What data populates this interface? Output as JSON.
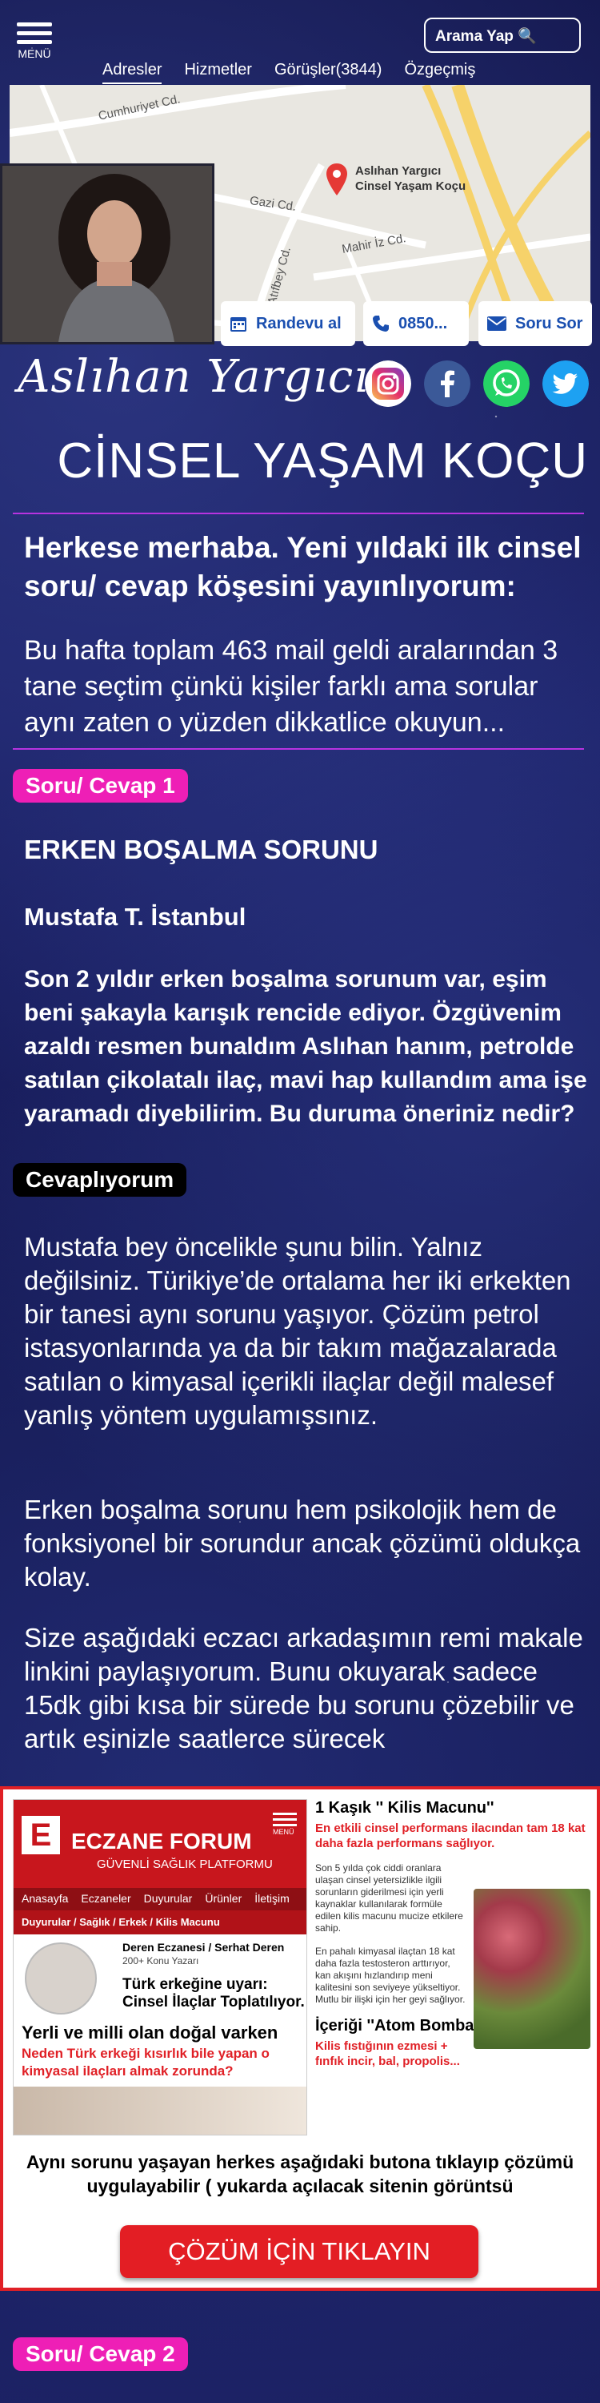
{
  "header": {
    "menu_label": "MENÜ",
    "search_label": "Arama Yap 🔍",
    "nav": [
      "Adresler",
      "Hizmetler",
      "Görüşler(3844)",
      "Özgeçmiş"
    ]
  },
  "map": {
    "streets": [
      "Cumhuriyet Cd.",
      "Gazi Cd.",
      "Mahir İz Cd.",
      "Atıfbey Cd."
    ],
    "pin_label_line1": "Aslıhan Yargıcı",
    "pin_label_line2": "Cinsel Yaşam Koçu"
  },
  "actions": {
    "appointment": "Randevu al",
    "phone": "0850...",
    "question": "Soru Sor"
  },
  "brand": {
    "signature": "Aslıhan Yargıcı",
    "title": "CİNSEL YAŞAM KOÇU",
    "social": [
      "instagram-icon",
      "facebook-icon",
      "whatsapp-icon",
      "twitter-icon"
    ]
  },
  "intro": {
    "lead": "Herkese merhaba. Yeni yıldaki ilk cinsel soru/ cevap köşesini yayınlıyorum:",
    "text": "Bu hafta toplam 463 mail geldi aralarından 3 tane seçtim çünkü kişiler farklı ama sorular aynı zaten o yüzden dikkatlice okuyun..."
  },
  "qa1": {
    "badge": "Soru/ Cevap 1",
    "question_title": "ERKEN BOŞALMA SORUNU",
    "author": "Mustafa T. İstanbul",
    "question": "Son 2 yıldır erken boşalma sorunum var, eşim beni şakayla karışık rencide ediyor. Özgüvenim azaldı resmen bunaldım Aslıhan hanım, petrolde satılan çikolatalı ilaç, mavi hap kullandım ama işe yaramadı diyebilirim. Bu duruma öneriniz nedir?",
    "answer_badge": "Cevaplıyorum",
    "answer_p1": "Mustafa bey öncelikle şunu bilin. Yalnız değilsiniz. Türikiye’de ortalama her iki erkekten bir tanesi aynı sorunu yaşıyor. Çözüm petrol istasyonlarında ya da bir takım mağazalarada satılan o kimyasal içerikli ilaçlar değil malesef yanlış yöntem uygulamışsınız.",
    "answer_p2": "Erken boşalma sorunu hem psikolojik hem de fonksiyonel bir sorundur ancak çözümü oldukça kolay.",
    "answer_p3": "Size aşağıdaki eczacı arkadaşımın remi makale linkini paylaşıyorum. Bunu okuyarak sadece 15dk gibi kısa bir sürede bu sorunu çözebilir ve artık eşinizle saatlerce sürecek"
  },
  "ad": {
    "site_name": "ECZANE FORUM",
    "site_tagline": "GÜVENLİ SAĞLIK PLATFORMU",
    "menu_label": "MENÜ",
    "nav": [
      "Anasayfa",
      "Eczaneler",
      "Duyurular",
      "Ürünler",
      "İletişim"
    ],
    "crumb": "Duyurular / Sağlık / Erkek / Kilis Macunu",
    "author": "Deren Eczanesi / Serhat Deren",
    "author_meta": "200+ Konu Yazarı",
    "warning": "Türk erkeğine uyarı: Cinsel İlaçlar Toplatılıyor.",
    "headline": "Yerli ve milli olan doğal varken",
    "subheadline": "Neden Türk erkeği kısırlık bile yapan o kimyasal ilaçları almak zorunda?",
    "right_title": "1 Kaşık '' Kilis Macunu''",
    "right_red": "En etkili cinsel performans ilacından tam 18 kat daha fazla performans sağlıyor.",
    "right_p1": "Son 5 yılda çok ciddi oranlara ulaşan cinsel yetersizlikle ilgili sorunların giderilmesi için yerli kaynaklar kullanılarak formüle edilen kilis macunu mucize etkilere sahip.",
    "right_p2": "En pahalı kimyasal ilaçtan 18 kat daha fazla testosteron arttırıyor, kan akışını hızlandırıp meni kalitesini son seviyeye yükseltiyor. Mutlu bir ilişki için her geyi sağlıyor.",
    "right_title2": "İçeriği ''Atom Bombası'' gibi",
    "right_red2": "Kilis fıstığının ezmesi + fınfık incir, bal, propolis...",
    "text": "Aynı sorunu yaşayan herkes aşağıdaki butona tıklayıp çözümü uygulayabilir ( yukarda açılacak sitenin görüntsü",
    "cta": "ÇÖZÜM İÇİN TIKLAYIN"
  },
  "qa2": {
    "badge": "Soru/ Cevap 2"
  }
}
